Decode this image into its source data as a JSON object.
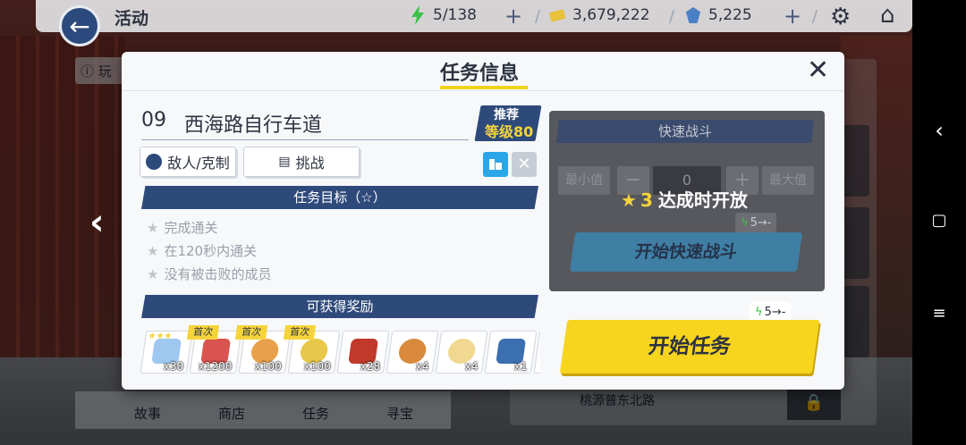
{
  "topbar": {
    "title": "活动",
    "stamina": "5/138",
    "gold": "3,679,222",
    "gems": "5,225"
  },
  "background": {
    "info_label": "玩",
    "tabs": [
      "故事",
      "商店",
      "任务",
      "寻宝"
    ],
    "route_label": "桃源普东北路"
  },
  "dialog": {
    "title": "任务信息",
    "mission_no": "09",
    "mission_name": "西海路自行车道",
    "recommend_label": "推荐",
    "recommend_level": "等级80",
    "enemy_button": "敌人/克制",
    "challenge_button": "挑战",
    "goals_header": "任务目标（☆）",
    "goals": [
      "完成通关",
      "在120秒内通关",
      "没有被击败的成员"
    ],
    "rewards_header": "可获得奖励",
    "first_clear_tag": "首次",
    "rewards": [
      {
        "qty": "x30",
        "first": false,
        "stars": "★★★",
        "color": "#9fc8f0"
      },
      {
        "qty": "x1200",
        "first": true,
        "stars": "",
        "color": "#d9534f"
      },
      {
        "qty": "x100",
        "first": true,
        "stars": "",
        "color": "#e8a14a"
      },
      {
        "qty": "x100",
        "first": true,
        "stars": "",
        "color": "#e8c84a"
      },
      {
        "qty": "x28",
        "first": false,
        "stars": "",
        "color": "#c0392b"
      },
      {
        "qty": "x4",
        "first": false,
        "stars": "",
        "color": "#d8893b"
      },
      {
        "qty": "x4",
        "first": false,
        "stars": "",
        "color": "#f0d890"
      },
      {
        "qty": "x1",
        "first": false,
        "stars": "",
        "color": "#3b6fb0"
      }
    ],
    "quick_battle": {
      "title": "快速战斗",
      "min_label": "最小值",
      "value": "0",
      "max_label": "最大值",
      "unlock_stars": "3",
      "unlock_text": "达成时开放",
      "cost": "5→-",
      "start_label": "开始快速战斗"
    },
    "start": {
      "cost": "5→-",
      "label": "开始任务"
    }
  }
}
